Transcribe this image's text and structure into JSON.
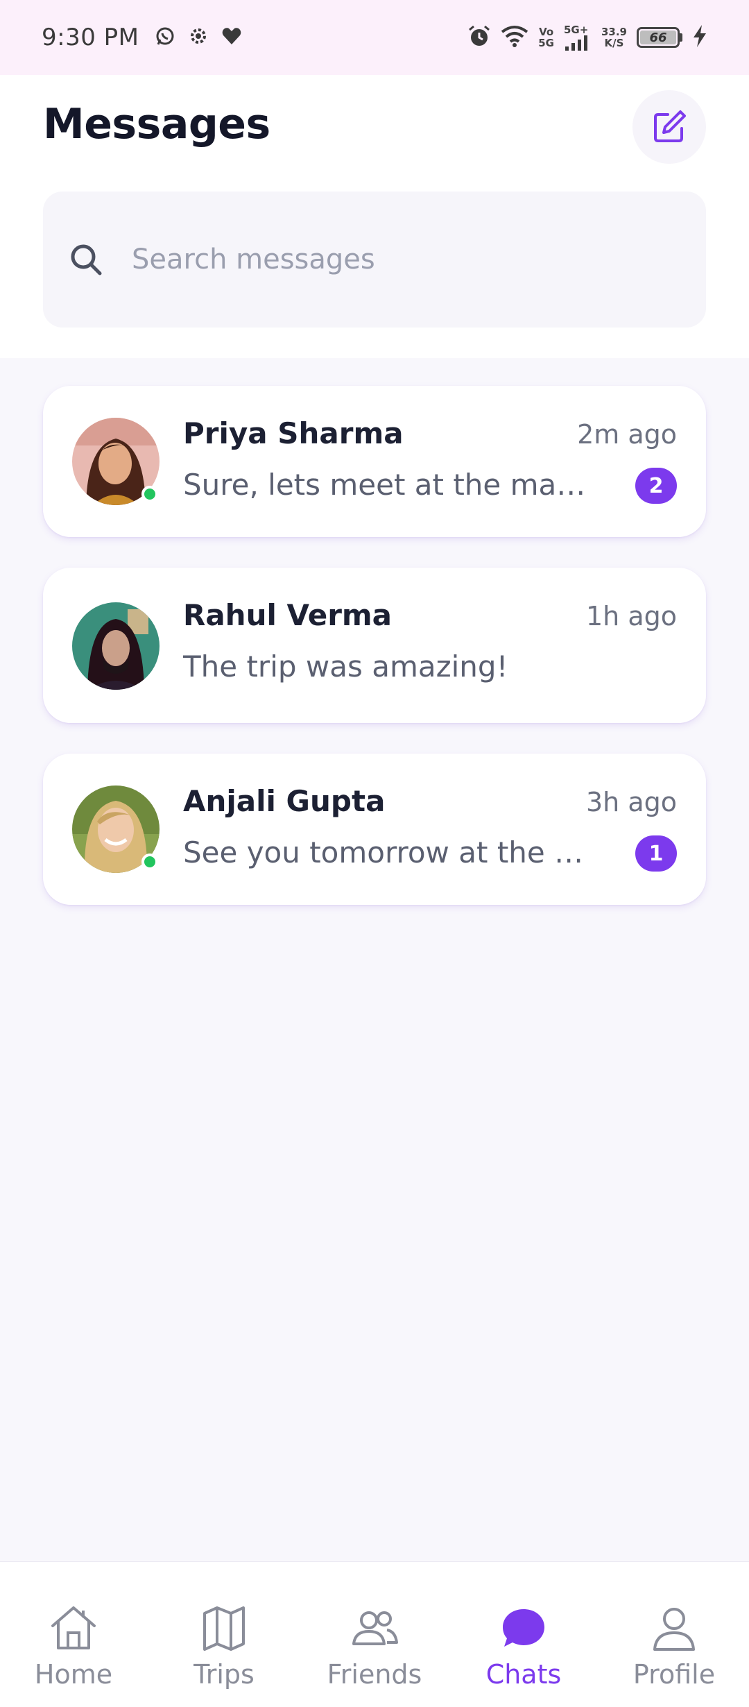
{
  "status_bar": {
    "time": "9:30 PM",
    "network_type_top": "Vo",
    "network_type_bottom": "5G",
    "signal_label": "5G+",
    "speed_value": "33.9",
    "speed_unit": "K/S",
    "battery_level": "66",
    "icons": [
      "whatsapp-icon",
      "settings-icon",
      "heart-icon",
      "alarm-icon",
      "wifi-icon",
      "signal-icon",
      "battery-icon",
      "charging-icon"
    ]
  },
  "header": {
    "title": "Messages",
    "compose_icon": "edit-square-icon"
  },
  "search": {
    "placeholder": "Search messages",
    "icon": "search-icon"
  },
  "chats": [
    {
      "name": "Priya Sharma",
      "time": "2m ago",
      "preview": "Sure, lets meet at the mall e...",
      "unread": "2",
      "online": true
    },
    {
      "name": "Rahul Verma",
      "time": "1h ago",
      "preview": "The trip was amazing!",
      "unread": "",
      "online": false
    },
    {
      "name": "Anjali Gupta",
      "time": "3h ago",
      "preview": "See you tomorrow at the ev...",
      "unread": "1",
      "online": true
    }
  ],
  "nav": {
    "items": [
      {
        "label": "Home",
        "icon": "home-icon"
      },
      {
        "label": "Trips",
        "icon": "map-icon"
      },
      {
        "label": "Friends",
        "icon": "users-icon"
      },
      {
        "label": "Chats",
        "icon": "chat-bubble-icon"
      },
      {
        "label": "Profile",
        "icon": "user-icon"
      }
    ],
    "active": "Chats"
  },
  "colors": {
    "accent": "#7c3aed",
    "online": "#22c55e",
    "status_bar_bg": "#fcf0fb",
    "list_bg": "#f8f7fc"
  }
}
